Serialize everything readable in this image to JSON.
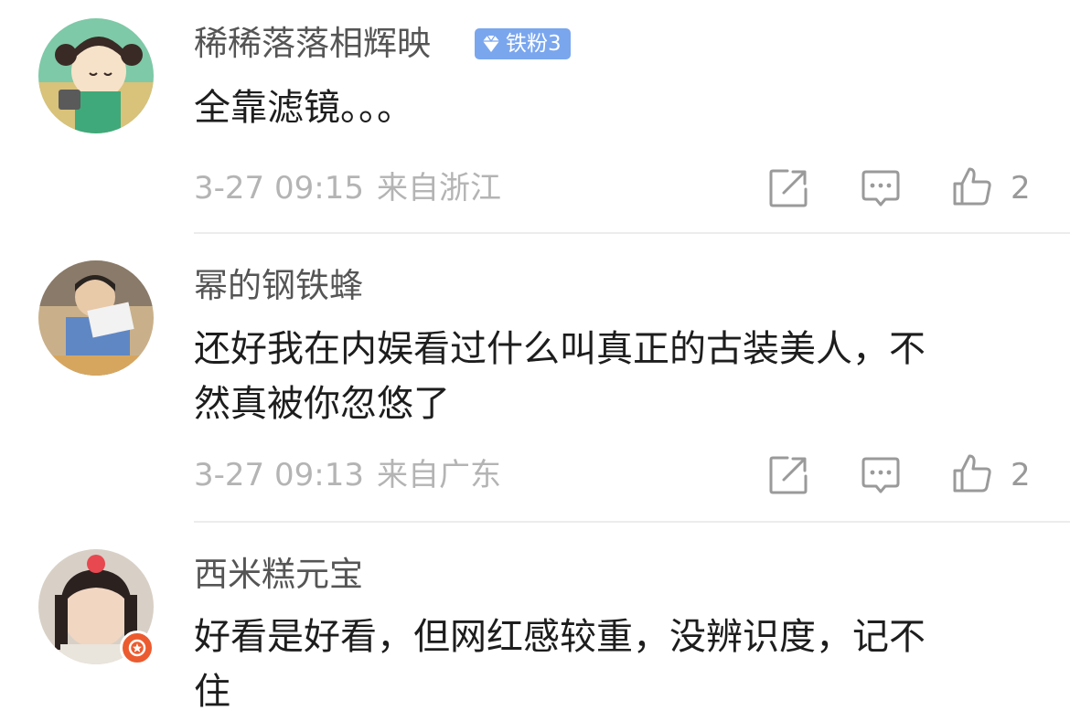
{
  "comments": [
    {
      "username": "稀稀落落相辉映",
      "badge": "铁粉3",
      "lines": [
        "全靠滤镜。。。"
      ],
      "time": "3-27 09:15",
      "location": "来自浙江",
      "likes": "2"
    },
    {
      "username": "幂的钢铁蜂",
      "lines": [
        "还好我在内娱看过什么叫真正的古装美人，不",
        "然真被你忽悠了"
      ],
      "time": "3-27 09:13",
      "location": "来自广东",
      "likes": "2"
    },
    {
      "username": "西米糕元宝",
      "lines": [
        "好看是好看，但网红感较重，没辨识度，记不",
        "住"
      ]
    }
  ],
  "icons": {
    "share": "share-icon",
    "reply": "comment-icon",
    "like": "thumbs-up-icon",
    "badge": "diamond-icon",
    "vip": "vip-badge-icon"
  },
  "colors": {
    "badge_bg": "#7aa6ee",
    "meta_text": "#b4b4b4",
    "vip_badge": "#ec5b2f"
  }
}
